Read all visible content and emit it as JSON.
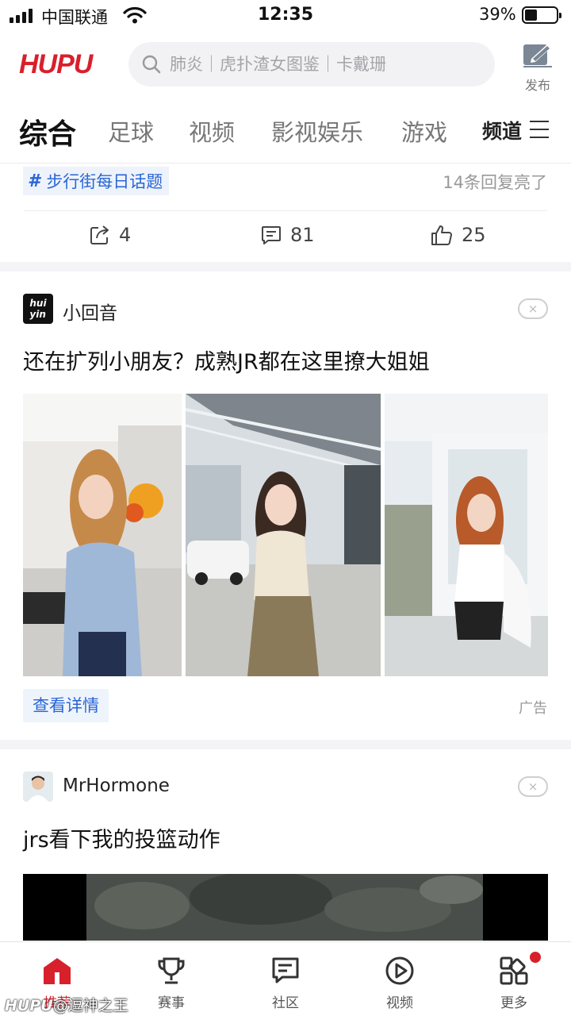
{
  "status_bar": {
    "carrier": "中国联通",
    "time": "12:35",
    "battery": "39%",
    "battery_level": 0.39
  },
  "header": {
    "logo": "HUPU",
    "search_placeholder": "肺炎｜虎扑渣女图鉴｜卡戴珊",
    "publish_label": "发布"
  },
  "tabs": {
    "items": [
      "综合",
      "足球",
      "视频",
      "影视娱乐",
      "游戏"
    ],
    "active": "综合",
    "channel_label": "频道"
  },
  "topic": {
    "tag": "步行街每日话题",
    "replies": "14条回复亮了"
  },
  "actions": {
    "share_count": "4",
    "comment_count": "81",
    "like_count": "25"
  },
  "ad_card": {
    "author": "小回音",
    "title": "还在扩列小朋友？成熟JR都在这里撩大姐姐",
    "detail_button": "查看详情",
    "ad_label": "广告",
    "close": "×"
  },
  "post_card": {
    "author": "MrHormone",
    "title": "jrs看下我的投篮动作",
    "close": "×"
  },
  "bottom_nav": {
    "items": [
      {
        "label": "推荐",
        "icon": "home-icon",
        "active": true
      },
      {
        "label": "赛事",
        "icon": "trophy-icon",
        "active": false
      },
      {
        "label": "社区",
        "icon": "chat-icon",
        "active": false
      },
      {
        "label": "视频",
        "icon": "play-icon",
        "active": false
      },
      {
        "label": "更多",
        "icon": "grid-icon",
        "active": false
      }
    ]
  },
  "watermark": {
    "logo": "HUPU",
    "text": "@逗神之王"
  },
  "colors": {
    "brand_red": "#d8202c",
    "link_blue": "#2a66d6"
  }
}
